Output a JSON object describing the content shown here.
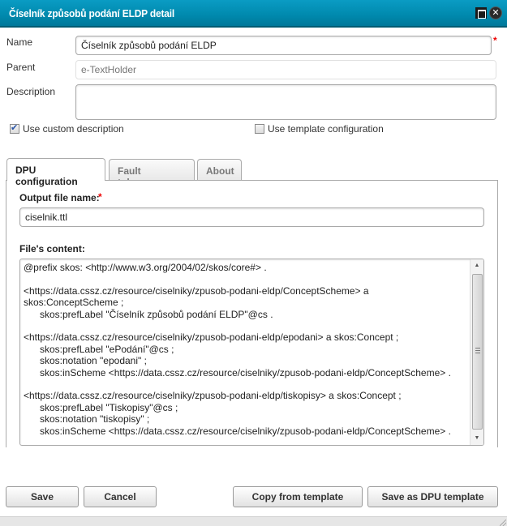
{
  "window": {
    "title": "Číselník způsobů podání ELDP detail",
    "maximize_icon": "maximize-icon",
    "close_icon": "close-icon",
    "close_glyph": "✕"
  },
  "form": {
    "name_label": "Name",
    "name_value": "Číselník způsobů podání ELDP",
    "required_mark": "*",
    "parent_label": "Parent",
    "parent_placeholder": "e-TextHolder",
    "description_label": "Description",
    "description_value": "",
    "use_custom_description": {
      "label": "Use custom description",
      "checked": true
    },
    "use_template_configuration": {
      "label": "Use template configuration",
      "checked": false
    }
  },
  "tabs": [
    {
      "label": "DPU configuration",
      "active": true
    },
    {
      "label": "Fault tolerance",
      "active": false
    },
    {
      "label": "About",
      "active": false
    }
  ],
  "dpu_config": {
    "output_file_label": "Output file name:",
    "required_mark": "*",
    "output_file_value": "ciselnik.ttl",
    "content_label": "File's content:",
    "content_value": "@prefix skos: <http://www.w3.org/2004/02/skos/core#> .\n\n<https://data.cssz.cz/resource/ciselniky/zpusob-podani-eldp/ConceptScheme> a\nskos:ConceptScheme ;\n      skos:prefLabel \"Číselník způsobů podání ELDP\"@cs .\n\n<https://data.cssz.cz/resource/ciselniky/zpusob-podani-eldp/epodani> a skos:Concept ;\n      skos:prefLabel \"ePodání\"@cs ;\n      skos:notation \"epodani\" ;\n      skos:inScheme <https://data.cssz.cz/resource/ciselniky/zpusob-podani-eldp/ConceptScheme> .\n\n<https://data.cssz.cz/resource/ciselniky/zpusob-podani-eldp/tiskopisy> a skos:Concept ;\n      skos:prefLabel \"Tiskopisy\"@cs ;\n      skos:notation \"tiskopisy\" ;\n      skos:inScheme <https://data.cssz.cz/resource/ciselniky/zpusob-podani-eldp/ConceptScheme> ."
  },
  "buttons": {
    "save": "Save",
    "cancel": "Cancel",
    "copy_from_template": "Copy from template",
    "save_as_dpu_template": "Save as DPU template"
  },
  "scrollbar": {
    "up_glyph": "▲",
    "down_glyph": "▼"
  }
}
